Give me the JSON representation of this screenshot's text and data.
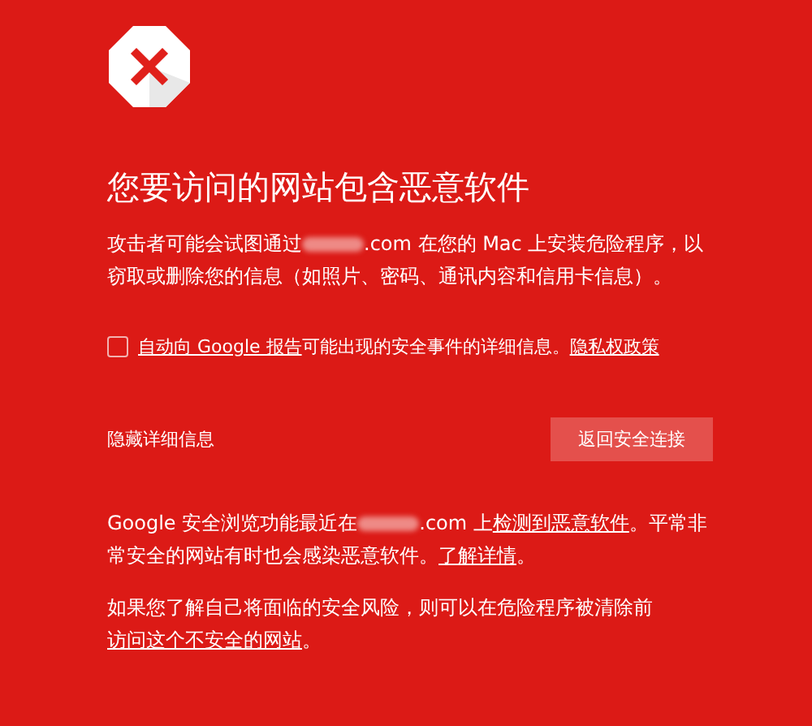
{
  "title": "您要访问的网站包含恶意软件",
  "intro": [
    {
      "kind": "text",
      "text": "攻击者可能会试图通过"
    },
    {
      "kind": "redacted"
    },
    {
      "kind": "text",
      "text": ".com 在您的 Mac 上安装危险程序，以窃取或删除您的信息（如照片、密码、通讯内容和信用卡信息）。"
    }
  ],
  "report": {
    "checked": false,
    "segments": [
      {
        "kind": "link",
        "text": "自动向 Google 报告"
      },
      {
        "kind": "text",
        "text": "可能出现的安全事件的详细信息。"
      },
      {
        "kind": "link",
        "text": "隐私权政策"
      }
    ]
  },
  "details_toggle": "隐藏详细信息",
  "back_button": "返回安全连接",
  "details": [
    {
      "segments": [
        {
          "kind": "text",
          "text": "Google 安全浏览功能最近在"
        },
        {
          "kind": "redacted"
        },
        {
          "kind": "text",
          "text": ".com 上"
        },
        {
          "kind": "link",
          "text": "检测到恶意软件"
        },
        {
          "kind": "text",
          "text": "。平常非常安全的网站有时也会感染恶意软件。"
        },
        {
          "kind": "link",
          "text": "了解详情"
        },
        {
          "kind": "text",
          "text": "。"
        }
      ]
    },
    {
      "segments": [
        {
          "kind": "text",
          "text": "如果您了解自己将面临的安全风险，则可以在危险程序被清除前"
        },
        {
          "kind": "link",
          "text": "访问这个不安全的网站"
        },
        {
          "kind": "text",
          "text": "。"
        }
      ]
    }
  ]
}
